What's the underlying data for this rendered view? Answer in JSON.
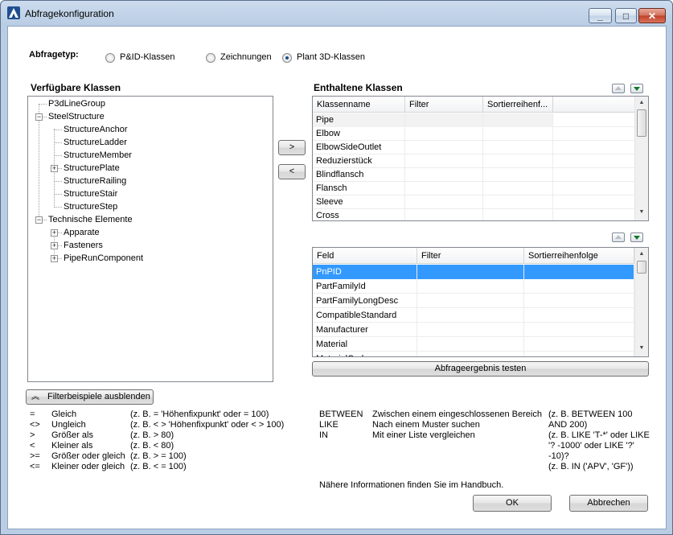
{
  "window": {
    "title": "Abfragekonfiguration",
    "minimize_glyph": "_",
    "maximize_glyph": "□",
    "close_glyph": "✕"
  },
  "query_type": {
    "label": "Abfragetyp:",
    "options": [
      {
        "label": "P&ID-Klassen",
        "checked": false
      },
      {
        "label": "Zeichnungen",
        "checked": false
      },
      {
        "label": "Plant 3D-Klassen",
        "checked": true
      }
    ]
  },
  "available": {
    "heading": "Verfügbare Klassen",
    "tree": [
      {
        "label": "P3dLineGroup",
        "level": 0,
        "expander": ""
      },
      {
        "label": "SteelStructure",
        "level": 0,
        "expander": "−"
      },
      {
        "label": "StructureAnchor",
        "level": 1,
        "expander": ""
      },
      {
        "label": "StructureLadder",
        "level": 1,
        "expander": ""
      },
      {
        "label": "StructureMember",
        "level": 1,
        "expander": ""
      },
      {
        "label": "StructurePlate",
        "level": 1,
        "expander": "+"
      },
      {
        "label": "StructureRailing",
        "level": 1,
        "expander": ""
      },
      {
        "label": "StructureStair",
        "level": 1,
        "expander": ""
      },
      {
        "label": "StructureStep",
        "level": 1,
        "expander": ""
      },
      {
        "label": "Technische Elemente",
        "level": 0,
        "expander": "−"
      },
      {
        "label": "Apparate",
        "level": 1,
        "expander": "+"
      },
      {
        "label": "Fasteners",
        "level": 1,
        "expander": "+"
      },
      {
        "label": "PipeRunComponent",
        "level": 1,
        "expander": "+"
      }
    ]
  },
  "transfer": {
    "add_label": ">",
    "remove_label": "<"
  },
  "included": {
    "heading": "Enthaltene Klassen",
    "columns": [
      "Klassenname",
      "Filter",
      "Sortierreihenf..."
    ],
    "rows": [
      [
        "Pipe",
        "",
        ""
      ],
      [
        "Elbow",
        "",
        ""
      ],
      [
        "ElbowSideOutlet",
        "",
        ""
      ],
      [
        "Reduzierstück",
        "",
        ""
      ],
      [
        "Blindflansch",
        "",
        ""
      ],
      [
        "Flansch",
        "",
        ""
      ],
      [
        "Sleeve",
        "",
        ""
      ],
      [
        "Cross",
        "",
        ""
      ]
    ],
    "selected_row": 0
  },
  "fields": {
    "columns": [
      "Feld",
      "Filter",
      "Sortierreihenfolge"
    ],
    "rows": [
      [
        "PnPID",
        "",
        ""
      ],
      [
        "PartFamilyId",
        "",
        ""
      ],
      [
        "PartFamilyLongDesc",
        "",
        ""
      ],
      [
        "CompatibleStandard",
        "",
        ""
      ],
      [
        "Manufacturer",
        "",
        ""
      ],
      [
        "Material",
        "",
        ""
      ],
      [
        "MaterialCode",
        "",
        ""
      ]
    ],
    "selected_row": 0,
    "test_button": "Abfrageergebnis testen"
  },
  "filter_toggle": {
    "label": "Filterbeispiele ausblenden",
    "icon": "double-chevron-up-icon"
  },
  "operators": [
    {
      "op": "=",
      "name": "Gleich",
      "example": "(z. B. = 'Höhenfixpunkt' oder = 100)"
    },
    {
      "op": "<>",
      "name": "Ungleich",
      "example": "(z. B. < > 'Höhenfixpunkt' oder < > 100)"
    },
    {
      "op": ">",
      "name": "Größer als",
      "example": "(z. B. > 80)"
    },
    {
      "op": "<",
      "name": "Kleiner als",
      "example": "(z. B. < 80)"
    },
    {
      "op": ">=",
      "name": "Größer oder gleich",
      "example": "(z. B. > = 100)"
    },
    {
      "op": "<=",
      "name": "Kleiner oder gleich",
      "example": "(z. B. < = 100)"
    }
  ],
  "keywords": [
    {
      "op": "BETWEEN",
      "name": "Zwischen einem eingeschlossenen Bereich"
    },
    {
      "op": "LIKE",
      "name": "Nach einem Muster suchen"
    },
    {
      "op": "IN",
      "name": "Mit einer Liste vergleichen"
    }
  ],
  "keyword_examples": [
    "(z. B. BETWEEN 100",
    "AND 200)",
    "(z. B. LIKE 'T-*' oder LIKE",
    "'? -1000' oder LIKE '?'",
    "-10)?",
    "(z. B. IN ('APV', 'GF'))"
  ],
  "help_note": "Nähere Informationen finden Sie im Handbuch.",
  "buttons": {
    "ok": "OK",
    "cancel": "Abbrechen"
  },
  "colors": {
    "selection": "#3399ff",
    "accent_green": "#0d7a2a"
  }
}
